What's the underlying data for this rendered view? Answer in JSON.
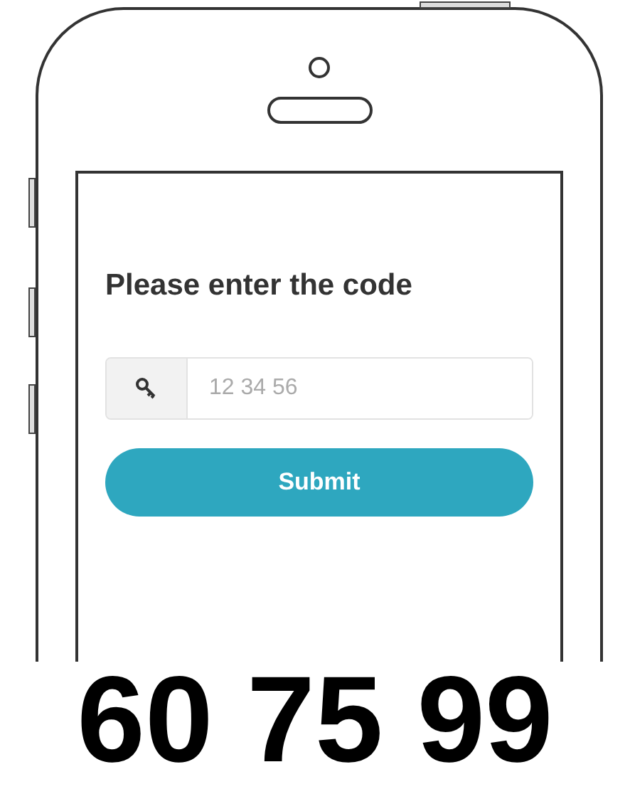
{
  "screen": {
    "heading": "Please enter the code",
    "code_field": {
      "placeholder": "12 34 56"
    },
    "submit_button": "Submit"
  },
  "caption": "60 75 99"
}
